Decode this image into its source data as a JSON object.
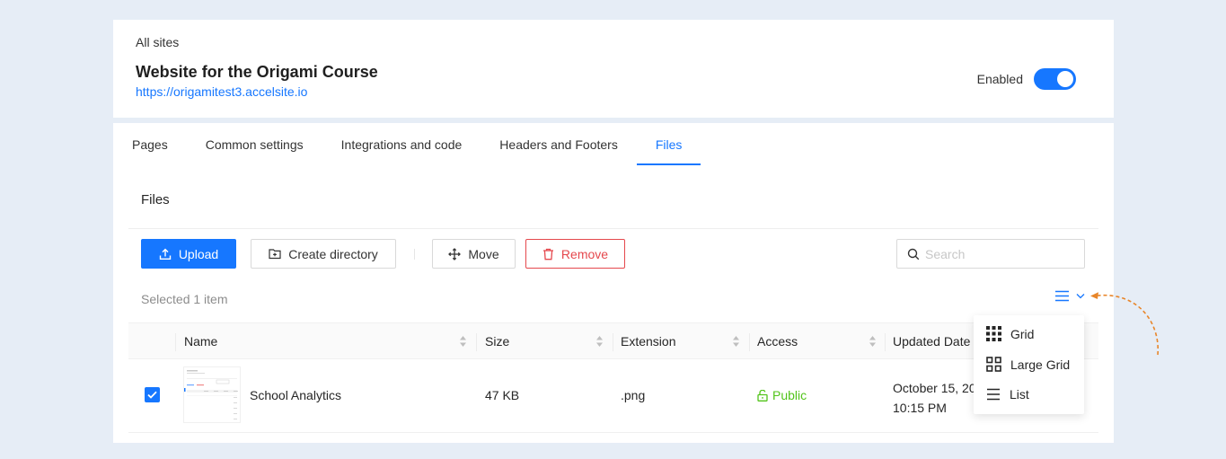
{
  "site": {
    "breadcrumb": "All sites",
    "title": "Website for the Origami Course",
    "url": "https://origamitest3.accelsite.io",
    "enabled_label": "Enabled"
  },
  "tabs": [
    {
      "label": "Pages"
    },
    {
      "label": "Common settings"
    },
    {
      "label": "Integrations and code"
    },
    {
      "label": "Headers and Footers"
    },
    {
      "label": "Files",
      "active": true
    }
  ],
  "files": {
    "section_title": "Files",
    "toolbar": {
      "upload_label": "Upload",
      "create_dir_label": "Create directory",
      "move_label": "Move",
      "remove_label": "Remove"
    },
    "search": {
      "placeholder": "Search",
      "value": ""
    },
    "selected_text": "Selected 1 item",
    "columns": [
      "Name",
      "Size",
      "Extension",
      "Access",
      "Updated Date"
    ],
    "rows": [
      {
        "name": "School Analytics",
        "size": "47 KB",
        "extension": ".png",
        "access": "Public",
        "updated_date": "October 15, 20",
        "updated_time": "10:15 PM",
        "selected": true
      }
    ],
    "view_menu": {
      "items": [
        {
          "label": "Grid",
          "icon": "grid-icon"
        },
        {
          "label": "Large Grid",
          "icon": "large-grid-icon"
        },
        {
          "label": "List",
          "icon": "list-icon"
        }
      ]
    }
  },
  "colors": {
    "accent": "#1677ff",
    "danger": "#e5484d",
    "success": "#52c41a",
    "annotation_arrow": "#e8862a",
    "page_background": "#e6edf6"
  }
}
